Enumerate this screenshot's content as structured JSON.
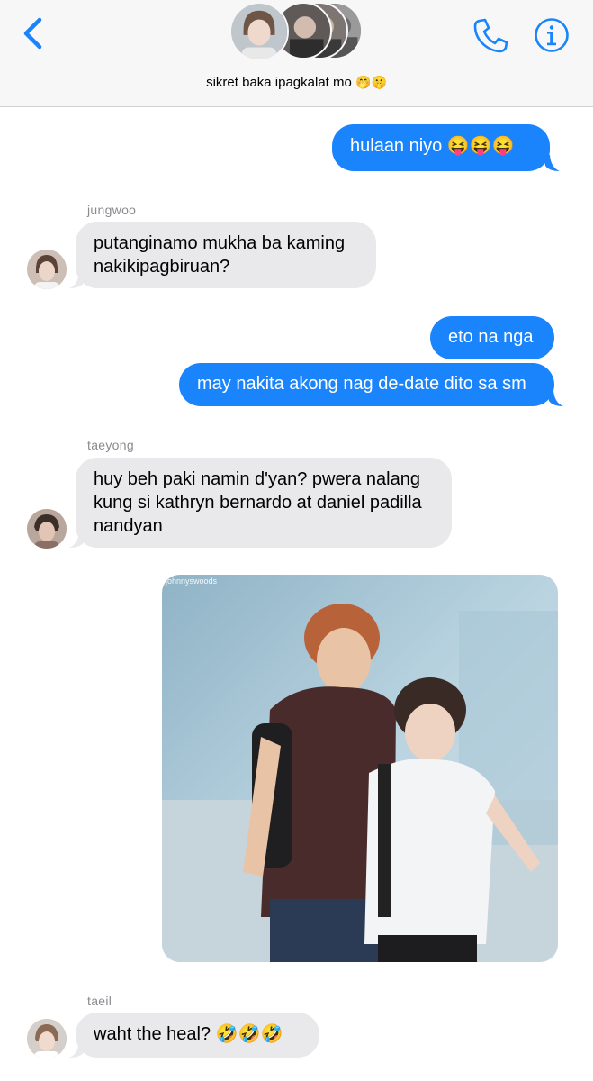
{
  "header": {
    "group_name": "sikret baka ipagkalat mo",
    "group_emoji": "🤭🤫",
    "back_icon": "chevron-left-icon",
    "call_icon": "phone-icon",
    "info_icon": "info-icon",
    "accent": "#1a84fd"
  },
  "messages": {
    "m1": {
      "text": "hulaan niyo",
      "emoji": "😝😝😝"
    },
    "m2": {
      "sender": "jungwoo",
      "line1": "putanginamo mukha ba kaming",
      "line2": "nakikipagbiruan?"
    },
    "m3": {
      "text": "eto na nga"
    },
    "m4": {
      "text": "may nakita akong nag de-date dito sa sm"
    },
    "m5": {
      "sender": "taeyong",
      "line1": "huy beh paki namin d'yan? pwera nalang",
      "line2": "kung si kathryn bernardo at daniel padilla",
      "line3": "nandyan"
    },
    "m6": {
      "watermark": "johnnyswoods"
    },
    "m7": {
      "sender": "taeil",
      "text": "waht the heal?",
      "emoji": "🤣🤣🤣"
    }
  },
  "colors": {
    "outgoing_bubble": "#1a84fd",
    "incoming_bubble": "#e9e9eb",
    "sender_label": "#8a8a8e"
  }
}
